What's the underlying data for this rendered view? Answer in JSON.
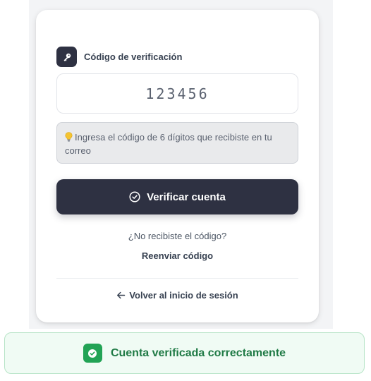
{
  "verification": {
    "label": "Código de verificación",
    "code_value": "123456",
    "hint_text": "Ingresa el código de 6 dígitos que recibiste en tu correo",
    "verify_button_label": "Verificar cuenta",
    "resend_question": "¿No recibiste el código?",
    "resend_link_label": "Reenviar código",
    "back_link_label": "Volver al inicio de sesión"
  },
  "toast": {
    "message": "Cuenta verificada correctamente",
    "status": "success"
  },
  "icons": {
    "field": "key-icon",
    "hint": "lightbulb-icon",
    "verify": "check-circle-icon",
    "back": "arrow-left-icon",
    "toast": "check-icon"
  },
  "colors": {
    "primary_dark": "#2e3142",
    "success": "#22a355",
    "success_text": "#1f7a45",
    "success_bg": "#f0fbf4",
    "hint_bg": "#e9eaec"
  }
}
